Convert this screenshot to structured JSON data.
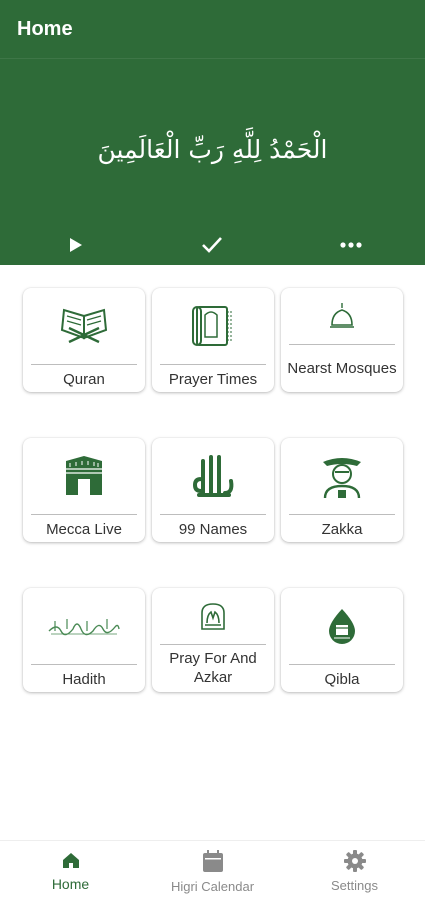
{
  "header": {
    "title": "Home",
    "arabic_text": "الْحَمْدُ لِلَّهِ رَبِّ الْعَالَمِينَ",
    "background": "#2e6b38",
    "actions": [
      "play-icon",
      "check-icon",
      "more-horizontal-icon"
    ]
  },
  "grid": [
    {
      "label": "Quran",
      "icon": "quran-book-icon"
    },
    {
      "label": "Prayer Times",
      "icon": "prayer-mat-icon"
    },
    {
      "label": "Nearst Mosques",
      "icon": "mosque-dome-icon"
    },
    {
      "label": "Mecca Live",
      "icon": "kaaba-icon"
    },
    {
      "label": "99 Names",
      "icon": "allah-calligraphy-icon"
    },
    {
      "label": "Zakka",
      "icon": "zakat-person-icon"
    },
    {
      "label": "Hadith",
      "icon": "hadith-calligraphy-icon"
    },
    {
      "label": "Pray For And Azkar",
      "icon": "dua-hands-icon"
    },
    {
      "label": "Qibla",
      "icon": "qibla-compass-icon"
    }
  ],
  "bottom_nav": {
    "items": [
      {
        "label": "Home",
        "icon": "home-icon",
        "active": true
      },
      {
        "label": "Higri Calendar",
        "icon": "calendar-icon",
        "active": false
      },
      {
        "label": "Settings",
        "icon": "gear-icon",
        "active": false
      }
    ],
    "active_color": "#2e6b38",
    "inactive_color": "#8a8a8a"
  }
}
